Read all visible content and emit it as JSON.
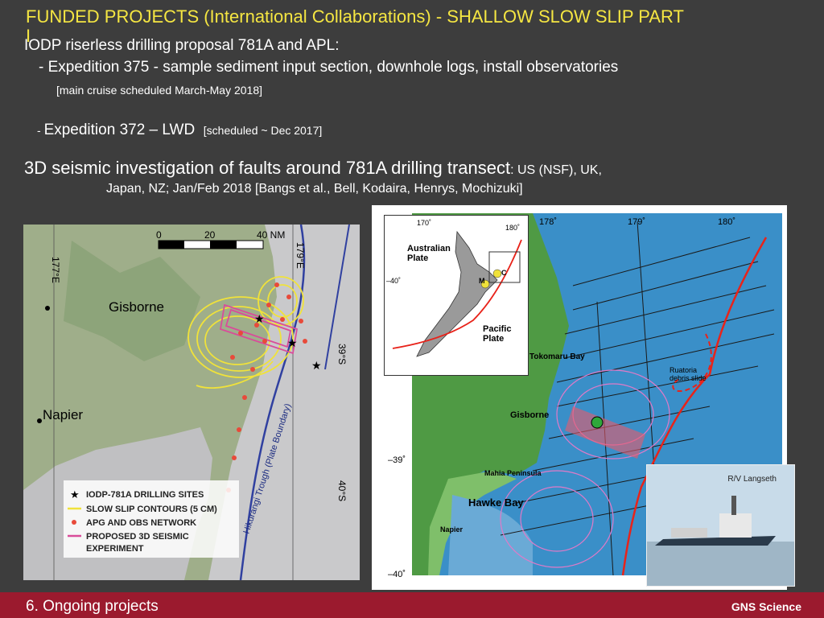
{
  "header": {
    "title_line1": "FUNDED PROJECTS (International Collaborations) - SHALLOW SLOW SLIP PART",
    "title_line2": "I"
  },
  "bullets": {
    "iodp": "IODP riserless drilling proposal 781A and APL:",
    "exp375": "- Expedition 375 - sample sediment input section, downhole logs, install observatories",
    "exp375_note": "[main cruise scheduled March-May 2018]",
    "exp372_dash": "- ",
    "exp372": "Expedition 372 – LWD",
    "exp372_note": "[scheduled ~ Dec 2017]",
    "seismic_main": "3D seismic investigation of faults around 781A drilling transect",
    "seismic_partners": ": US (NSF), UK,",
    "seismic_line2": "Japan, NZ; Jan/Feb 2018 [Bangs et al., Bell, Kodaira, Henrys, Mochizuki]"
  },
  "left_map": {
    "scale_0": "0",
    "scale_20": "20",
    "scale_40": "40 NM",
    "lon_177": "177°E",
    "lon_179": "179°E",
    "lat_39": "39°S",
    "lat_40": "40°S",
    "city_gisborne": "Gisborne",
    "city_napier": "Napier",
    "trough": "Hikurangi Trough (Plate Boundary)",
    "legend": {
      "sites": "IODP-781A DRILLING SITES",
      "contours": "SLOW SLIP CONTOURS (5 CM)",
      "network": "APG AND OBS NETWORK",
      "seismic": "PROPOSED 3D SEISMIC",
      "seismic2": "EXPERIMENT"
    },
    "colors": {
      "sea": "#c9c9cb",
      "land": "#9fae8a",
      "contours": "#f0e23a",
      "seismic": "#d94c9a",
      "network": "#e84a3a"
    }
  },
  "right_map": {
    "lon_178": "178˚",
    "lon_179": "179˚",
    "lon_180": "180˚",
    "lat_39": "–39˚",
    "lat_40": "–40˚",
    "place_tokomaru": "Tokomaru Bay",
    "place_gisborne": "Gisborne",
    "place_mahia": "Mahia Peninsula",
    "place_hawke": "Hawke Bay",
    "place_napier": "Napier",
    "place_ruatoria": "Ruatoria",
    "place_ruatoria2": "debris slide",
    "colors": {
      "sea": "#3a8fc8",
      "land": "#4f9a44",
      "fault": "#e8231a",
      "lines": "#1a1a1a"
    }
  },
  "inset_map": {
    "lon_170": "170˚",
    "lon_180": "180˚",
    "lat_40": "–40˚",
    "australian": "Australian",
    "australian2": "Plate",
    "pacific": "Pacific",
    "pacific2": "Plate",
    "m": "M",
    "c": "C"
  },
  "ship_photo": {
    "caption": "R/V Langseth"
  },
  "footer": {
    "left": "6. Ongoing projects",
    "right": "GNS Science"
  }
}
